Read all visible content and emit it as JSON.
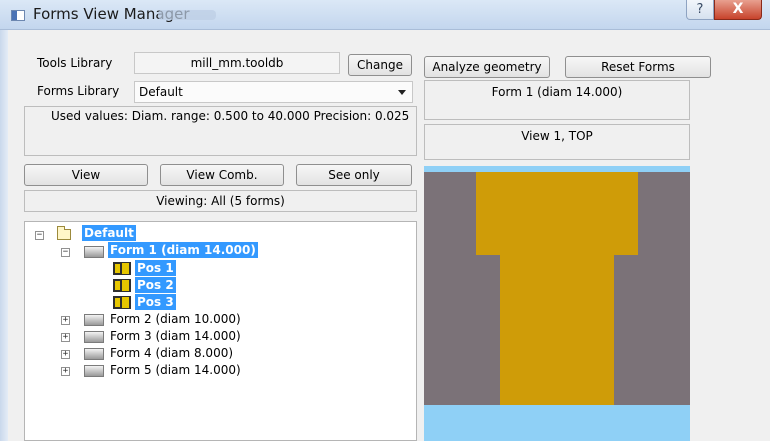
{
  "window": {
    "title": "Forms View Manager",
    "help_label": "?",
    "close_label": "X"
  },
  "tools": {
    "label": "Tools Library",
    "value": "mill_mm.tooldb",
    "change_label": "Change"
  },
  "forms": {
    "label": "Forms Library",
    "selected": "Default"
  },
  "used_values": "Used values:  Diam. range: 0.500 to 40.000  Precision: 0.025",
  "right": {
    "analyze_label": "Analyze geometry",
    "reset_label": "Reset Forms",
    "form_caption": "Form 1 (diam 14.000)",
    "view_caption": "View 1,  TOP"
  },
  "view_buttons": {
    "view": "View",
    "view_comb": "View Comb.",
    "see_only": "See only"
  },
  "viewing_status": "Viewing: All (5 forms)",
  "tree": {
    "root": "Default",
    "form1": "Form 1 (diam 14.000)",
    "positions": [
      "Pos 1",
      "Pos 2",
      "Pos 3"
    ],
    "forms": [
      "Form 2 (diam 10.000)",
      "Form 3 (diam 14.000)",
      "Form 4 (diam 8.000)",
      "Form 5 (diam 14.000)"
    ]
  },
  "colors": {
    "selection": "#3399ff",
    "tool_gold": "#cf9c08",
    "stock_gray": "#7b7278",
    "sky_blue": "#8fd0f6"
  }
}
